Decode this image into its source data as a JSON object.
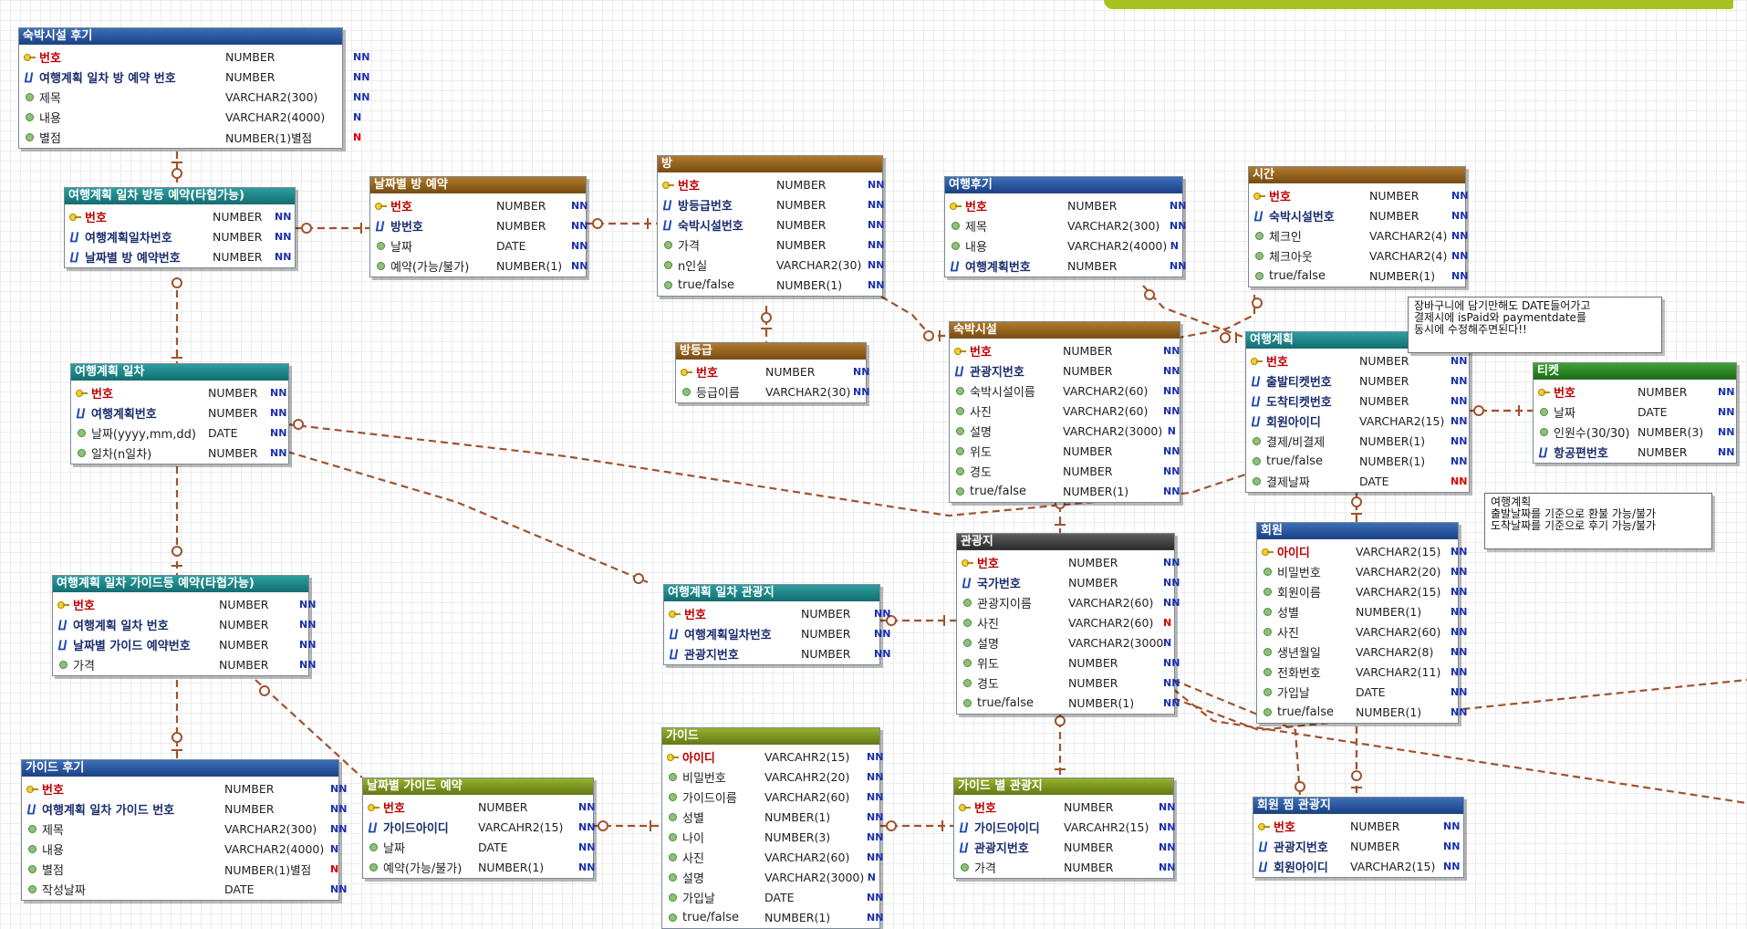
{
  "entities": {
    "e1": {
      "title": "숙박시설 후기",
      "rows": [
        {
          "kind": "pk",
          "name": "번호",
          "type": "NUMBER",
          "nn": "NN",
          "red": false
        },
        {
          "kind": "fk",
          "name": "여행계획 일차 방 예약 번호",
          "type": "NUMBER",
          "nn": "NN",
          "red": false
        },
        {
          "kind": "col",
          "name": "제목",
          "type": "VARCHAR2(300)",
          "nn": "NN",
          "red": false
        },
        {
          "kind": "col",
          "name": "내용",
          "type": "VARCHAR2(4000)",
          "nn": "N",
          "red": false
        },
        {
          "kind": "col",
          "name": "별점",
          "type": "NUMBER(1)별점",
          "nn": "N",
          "red": true
        }
      ]
    },
    "e2": {
      "title": "여행계획 일차 방등 예약(타협가능)",
      "rows": [
        {
          "kind": "pk",
          "name": "번호",
          "type": "NUMBER",
          "nn": "NN",
          "red": false
        },
        {
          "kind": "fk",
          "name": "여행계획일차번호",
          "type": "NUMBER",
          "nn": "NN",
          "red": false
        },
        {
          "kind": "fk",
          "name": "날짜별 방 예약번호",
          "type": "NUMBER",
          "nn": "NN",
          "red": false
        }
      ]
    },
    "e3": {
      "title": "날짜별 방 예약",
      "rows": [
        {
          "kind": "pk",
          "name": "번호",
          "type": "NUMBER",
          "nn": "NN",
          "red": false
        },
        {
          "kind": "fk",
          "name": "방번호",
          "type": "NUMBER",
          "nn": "NN",
          "red": false
        },
        {
          "kind": "col",
          "name": "날짜",
          "type": "DATE",
          "nn": "NN",
          "red": false
        },
        {
          "kind": "col",
          "name": "예약(가능/불가)",
          "type": "NUMBER(1)",
          "nn": "NN",
          "red": false
        }
      ]
    },
    "e4": {
      "title": "방",
      "rows": [
        {
          "kind": "pk",
          "name": "번호",
          "type": "NUMBER",
          "nn": "NN",
          "red": false
        },
        {
          "kind": "fk",
          "name": "방등급번호",
          "type": "NUMBER",
          "nn": "NN",
          "red": false
        },
        {
          "kind": "fk",
          "name": "숙박시설번호",
          "type": "NUMBER",
          "nn": "NN",
          "red": false
        },
        {
          "kind": "col",
          "name": "가격",
          "type": "NUMBER",
          "nn": "NN",
          "red": false
        },
        {
          "kind": "col",
          "name": "n인실",
          "type": "VARCHAR2(30)",
          "nn": "NN",
          "red": false
        },
        {
          "kind": "col",
          "name": "true/false",
          "type": "NUMBER(1)",
          "nn": "NN",
          "red": false
        }
      ]
    },
    "e5": {
      "title": "방등급",
      "rows": [
        {
          "kind": "pk",
          "name": "번호",
          "type": "NUMBER",
          "nn": "NN",
          "red": false
        },
        {
          "kind": "col",
          "name": "등급이름",
          "type": "VARCHAR2(30)",
          "nn": "NN",
          "red": false
        }
      ]
    },
    "e6": {
      "title": "여행후기",
      "rows": [
        {
          "kind": "pk",
          "name": "번호",
          "type": "NUMBER",
          "nn": "NN",
          "red": false
        },
        {
          "kind": "col",
          "name": "제목",
          "type": "VARCHAR2(300)",
          "nn": "NN",
          "red": false
        },
        {
          "kind": "col",
          "name": "내용",
          "type": "VARCHAR2(4000)",
          "nn": "N",
          "red": false
        },
        {
          "kind": "fk",
          "name": "여행계획번호",
          "type": "NUMBER",
          "nn": "NN",
          "red": false
        }
      ]
    },
    "e7": {
      "title": "시간",
      "rows": [
        {
          "kind": "pk",
          "name": "번호",
          "type": "NUMBER",
          "nn": "NN",
          "red": false
        },
        {
          "kind": "fk",
          "name": "숙박시설번호",
          "type": "NUMBER",
          "nn": "NN",
          "red": false
        },
        {
          "kind": "col",
          "name": "체크인",
          "type": "VARCHAR2(4)",
          "nn": "NN",
          "red": false
        },
        {
          "kind": "col",
          "name": "체크아웃",
          "type": "VARCHAR2(4)",
          "nn": "NN",
          "red": false
        },
        {
          "kind": "col",
          "name": "true/false",
          "type": "NUMBER(1)",
          "nn": "NN",
          "red": false
        }
      ]
    },
    "e8": {
      "title": "숙박시설",
      "rows": [
        {
          "kind": "pk",
          "name": "번호",
          "type": "NUMBER",
          "nn": "NN",
          "red": false
        },
        {
          "kind": "fk",
          "name": "관광지번호",
          "type": "NUMBER",
          "nn": "NN",
          "red": false
        },
        {
          "kind": "col",
          "name": "숙박시설이름",
          "type": "VARCHAR2(60)",
          "nn": "NN",
          "red": false
        },
        {
          "kind": "col",
          "name": "사진",
          "type": "VARCHAR2(60)",
          "nn": "NN",
          "red": false
        },
        {
          "kind": "col",
          "name": "설명",
          "type": "VARCHAR2(3000)",
          "nn": "N",
          "red": false
        },
        {
          "kind": "col",
          "name": "위도",
          "type": "NUMBER",
          "nn": "NN",
          "red": false
        },
        {
          "kind": "col",
          "name": "경도",
          "type": "NUMBER",
          "nn": "NN",
          "red": false
        },
        {
          "kind": "col",
          "name": "true/false",
          "type": "NUMBER(1)",
          "nn": "NN",
          "red": false
        }
      ]
    },
    "e9": {
      "title": "여행계획",
      "rows": [
        {
          "kind": "pk",
          "name": "번호",
          "type": "NUMBER",
          "nn": "NN",
          "red": false
        },
        {
          "kind": "fk",
          "name": "출발티켓번호",
          "type": "NUMBER",
          "nn": "NN",
          "red": false
        },
        {
          "kind": "fk",
          "name": "도착티켓번호",
          "type": "NUMBER",
          "nn": "NN",
          "red": false
        },
        {
          "kind": "fk",
          "name": "회원아이디",
          "type": "VARCHAR2(15)",
          "nn": "NN",
          "red": false
        },
        {
          "kind": "col",
          "name": "결제/비결제",
          "type": "NUMBER(1)",
          "nn": "NN",
          "red": false
        },
        {
          "kind": "col",
          "name": "true/false",
          "type": "NUMBER(1)",
          "nn": "NN",
          "red": false
        },
        {
          "kind": "col",
          "name": "결제날짜",
          "type": "DATE",
          "nn": "NN",
          "red": true
        }
      ]
    },
    "e10": {
      "title": "티켓",
      "rows": [
        {
          "kind": "pk",
          "name": "번호",
          "type": "NUMBER",
          "nn": "NN",
          "red": false
        },
        {
          "kind": "col",
          "name": "날짜",
          "type": "DATE",
          "nn": "NN",
          "red": false
        },
        {
          "kind": "col",
          "name": "인원수(30/30)",
          "type": "NUMBER(3)",
          "nn": "NN",
          "red": false
        },
        {
          "kind": "fk",
          "name": "항공편번호",
          "type": "NUMBER",
          "nn": "NN",
          "red": false
        }
      ]
    },
    "e11": {
      "title": "여행계획 일차",
      "rows": [
        {
          "kind": "pk",
          "name": "번호",
          "type": "NUMBER",
          "nn": "NN",
          "red": false
        },
        {
          "kind": "fk",
          "name": "여행계획번호",
          "type": "NUMBER",
          "nn": "NN",
          "red": false
        },
        {
          "kind": "col",
          "name": "날짜(yyyy,mm,dd)",
          "type": "DATE",
          "nn": "NN",
          "red": false
        },
        {
          "kind": "col",
          "name": "일차(n일차)",
          "type": "NUMBER",
          "nn": "NN",
          "red": false
        }
      ]
    },
    "e12": {
      "title": "관광지",
      "rows": [
        {
          "kind": "pk",
          "name": "번호",
          "type": "NUMBER",
          "nn": "NN",
          "red": false
        },
        {
          "kind": "fk",
          "name": "국가번호",
          "type": "NUMBER",
          "nn": "NN",
          "red": false
        },
        {
          "kind": "col",
          "name": "관광지이름",
          "type": "VARCHAR2(60)",
          "nn": "NN",
          "red": false
        },
        {
          "kind": "col",
          "name": "사진",
          "type": "VARCHAR2(60)",
          "nn": "N",
          "red": true
        },
        {
          "kind": "col",
          "name": "설명",
          "type": "VARCHAR2(3000)",
          "nn": "N",
          "red": false
        },
        {
          "kind": "col",
          "name": "위도",
          "type": "NUMBER",
          "nn": "NN",
          "red": false
        },
        {
          "kind": "col",
          "name": "경도",
          "type": "NUMBER",
          "nn": "NN",
          "red": false
        },
        {
          "kind": "col",
          "name": "true/false",
          "type": "NUMBER(1)",
          "nn": "NN",
          "red": false
        }
      ]
    },
    "e13": {
      "title": "회원",
      "rows": [
        {
          "kind": "pk",
          "name": "아이디",
          "type": "VARCHAR2(15)",
          "nn": "NN",
          "red": false
        },
        {
          "kind": "col",
          "name": "비밀번호",
          "type": "VARCHAR2(20)",
          "nn": "NN",
          "red": false
        },
        {
          "kind": "col",
          "name": "회원이름",
          "type": "VARCHAR2(15)",
          "nn": "NN",
          "red": false
        },
        {
          "kind": "col",
          "name": "성별",
          "type": "NUMBER(1)",
          "nn": "NN",
          "red": false
        },
        {
          "kind": "col",
          "name": "사진",
          "type": "VARCHAR2(60)",
          "nn": "NN",
          "red": false
        },
        {
          "kind": "col",
          "name": "생년월일",
          "type": "VARCHAR2(8)",
          "nn": "NN",
          "red": false
        },
        {
          "kind": "col",
          "name": "전화번호",
          "type": "VARCHAR2(11)",
          "nn": "NN",
          "red": false
        },
        {
          "kind": "col",
          "name": "가입날",
          "type": "DATE",
          "nn": "NN",
          "red": false
        },
        {
          "kind": "col",
          "name": "true/false",
          "type": "NUMBER(1)",
          "nn": "NN",
          "red": false
        }
      ]
    },
    "e14": {
      "title": "여행계획 일차 가이드등 예약(타협가능)",
      "rows": [
        {
          "kind": "pk",
          "name": "번호",
          "type": "NUMBER",
          "nn": "NN",
          "red": false
        },
        {
          "kind": "fk",
          "name": "여행계획 일차 번호",
          "type": "NUMBER",
          "nn": "NN",
          "red": false
        },
        {
          "kind": "fk",
          "name": "날짜별 가이드 예약번호",
          "type": "NUMBER",
          "nn": "NN",
          "red": false
        },
        {
          "kind": "col",
          "name": "가격",
          "type": "NUMBER",
          "nn": "NN",
          "red": false
        }
      ]
    },
    "e15": {
      "title": "여행계획 일차 관광지",
      "rows": [
        {
          "kind": "pk",
          "name": "번호",
          "type": "NUMBER",
          "nn": "NN",
          "red": false
        },
        {
          "kind": "fk",
          "name": "여행계획일차번호",
          "type": "NUMBER",
          "nn": "NN",
          "red": false
        },
        {
          "kind": "fk",
          "name": "관광지번호",
          "type": "NUMBER",
          "nn": "NN",
          "red": false
        }
      ]
    },
    "e16": {
      "title": "가이드 후기",
      "rows": [
        {
          "kind": "pk",
          "name": "번호",
          "type": "NUMBER",
          "nn": "NN",
          "red": false
        },
        {
          "kind": "fk",
          "name": "여행계획 일차 가이드 번호",
          "type": "NUMBER",
          "nn": "NN",
          "red": false
        },
        {
          "kind": "col",
          "name": "제목",
          "type": "VARCHAR2(300)",
          "nn": "NN",
          "red": false
        },
        {
          "kind": "col",
          "name": "내용",
          "type": "VARCHAR2(4000)",
          "nn": "N",
          "red": false
        },
        {
          "kind": "col",
          "name": "별점",
          "type": "NUMBER(1)별점",
          "nn": "N",
          "red": true
        },
        {
          "kind": "col",
          "name": "작성날짜",
          "type": "DATE",
          "nn": "NN",
          "red": false
        }
      ]
    },
    "e17": {
      "title": "날짜별 가이드 예약",
      "rows": [
        {
          "kind": "pk",
          "name": "번호",
          "type": "NUMBER",
          "nn": "NN",
          "red": false
        },
        {
          "kind": "fk",
          "name": "가이드아이디",
          "type": "VARCAHR2(15)",
          "nn": "NN",
          "red": false
        },
        {
          "kind": "col",
          "name": "날짜",
          "type": "DATE",
          "nn": "NN",
          "red": false
        },
        {
          "kind": "col",
          "name": "예약(가능/불가)",
          "type": "NUMBER(1)",
          "nn": "NN",
          "red": false
        }
      ]
    },
    "e18": {
      "title": "가이드",
      "rows": [
        {
          "kind": "pk",
          "name": "아이디",
          "type": "VARCAHR2(15)",
          "nn": "NN",
          "red": false
        },
        {
          "kind": "col",
          "name": "비밀번호",
          "type": "VARCAHR2(20)",
          "nn": "NN",
          "red": false
        },
        {
          "kind": "col",
          "name": "가이드이름",
          "type": "VARCHAR2(60)",
          "nn": "NN",
          "red": false
        },
        {
          "kind": "col",
          "name": "성별",
          "type": "NUMBER(1)",
          "nn": "NN",
          "red": false
        },
        {
          "kind": "col",
          "name": "나이",
          "type": "NUMBER(3)",
          "nn": "NN",
          "red": false
        },
        {
          "kind": "col",
          "name": "사진",
          "type": "VARCHAR2(60)",
          "nn": "NN",
          "red": false
        },
        {
          "kind": "col",
          "name": "설명",
          "type": "VARCHAR2(3000)",
          "nn": "N",
          "red": false
        },
        {
          "kind": "col",
          "name": "가입날",
          "type": "DATE",
          "nn": "NN",
          "red": false
        },
        {
          "kind": "col",
          "name": "true/false",
          "type": "NUMBER(1)",
          "nn": "NN",
          "red": false
        }
      ]
    },
    "e19": {
      "title": "가이드 별 관광지",
      "rows": [
        {
          "kind": "pk",
          "name": "번호",
          "type": "NUMBER",
          "nn": "NN",
          "red": false
        },
        {
          "kind": "fk",
          "name": "가이드아이디",
          "type": "VARCAHR2(15)",
          "nn": "NN",
          "red": false
        },
        {
          "kind": "fk",
          "name": "관광지번호",
          "type": "NUMBER",
          "nn": "NN",
          "red": false
        },
        {
          "kind": "col",
          "name": "가격",
          "type": "NUMBER",
          "nn": "NN",
          "red": false
        }
      ]
    },
    "e20": {
      "title": "회원 찜 관광지",
      "rows": [
        {
          "kind": "pk",
          "name": "번호",
          "type": "NUMBER",
          "nn": "NN",
          "red": false
        },
        {
          "kind": "fk",
          "name": "관광지번호",
          "type": "NUMBER",
          "nn": "NN",
          "red": false
        },
        {
          "kind": "fk",
          "name": "회원아이디",
          "type": "VARCHAR2(15)",
          "nn": "NN",
          "red": false
        }
      ]
    }
  },
  "notes": {
    "n1": "장바구니에 담기만해도 DATE들어가고\n결제시에 isPaid와 paymentdate를\n동시에 수정해주면된다!!",
    "n2": "여행계획\n출발날짜를 기준으로 환불 가능/불가\n도착날짜를 기준으로 후기 가능/불가"
  },
  "colors": {
    "relationship_line": "#a0522d",
    "banner": "#a7c31f"
  },
  "icons": {
    "pk": "primary-key-icon",
    "fk": "foreign-key-icon",
    "col": "column-icon"
  }
}
